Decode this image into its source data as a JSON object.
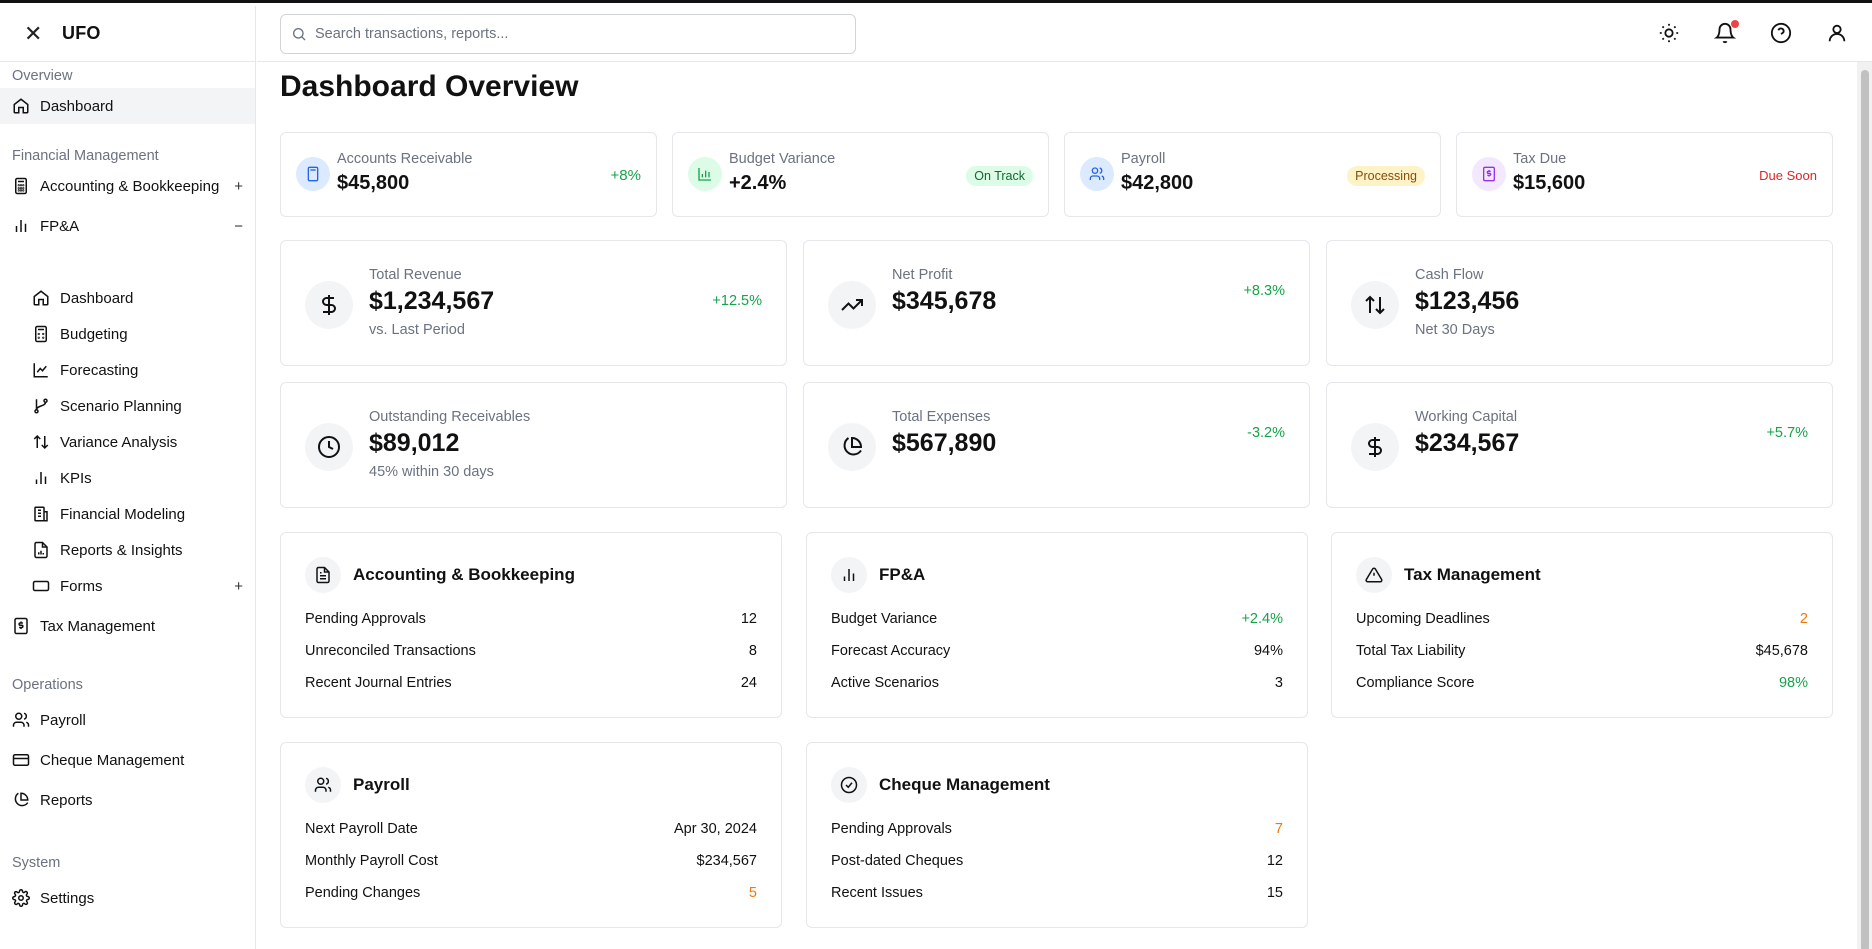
{
  "app": {
    "name": "UFO"
  },
  "search": {
    "placeholder": "Search transactions, reports..."
  },
  "sidebar": {
    "sections": [
      "Overview",
      "Financial Management",
      "Operations",
      "System"
    ],
    "items": {
      "dashboard": "Dashboard",
      "accounting": "Accounting & Bookkeeping",
      "fpa": "FP&A",
      "fpa_dashboard": "Dashboard",
      "budgeting": "Budgeting",
      "forecasting": "Forecasting",
      "scenario": "Scenario Planning",
      "variance": "Variance Analysis",
      "kpis": "KPIs",
      "modeling": "Financial Modeling",
      "reports_insights": "Reports & Insights",
      "forms": "Forms",
      "tax": "Tax Management",
      "payroll": "Payroll",
      "cheque": "Cheque Management",
      "reports": "Reports",
      "settings": "Settings"
    },
    "expand": {
      "plus": "+",
      "minus": "−"
    }
  },
  "page": {
    "title": "Dashboard Overview"
  },
  "summary": [
    {
      "label": "Accounts Receivable",
      "value": "$45,800",
      "tag": "+8%"
    },
    {
      "label": "Budget Variance",
      "value": "+2.4%",
      "tag": "On Track"
    },
    {
      "label": "Payroll",
      "value": "$42,800",
      "tag": "Processing"
    },
    {
      "label": "Tax Due",
      "value": "$15,600",
      "tag": "Due Soon"
    }
  ],
  "metrics": [
    {
      "label": "Total Revenue",
      "value": "$1,234,567",
      "sub": "vs. Last Period",
      "change": "+12.5%"
    },
    {
      "label": "Net Profit",
      "value": "$345,678",
      "change": "+8.3%"
    },
    {
      "label": "Cash Flow",
      "value": "$123,456",
      "sub": "Net 30 Days"
    },
    {
      "label": "Outstanding Receivables",
      "value": "$89,012",
      "sub": "45% within 30 days"
    },
    {
      "label": "Total Expenses",
      "value": "$567,890",
      "change": "-3.2%"
    },
    {
      "label": "Working Capital",
      "value": "$234,567",
      "change": "+5.7%"
    }
  ],
  "modules": [
    {
      "title": "Accounting & Bookkeeping",
      "rows": [
        [
          "Pending Approvals",
          "12"
        ],
        [
          "Unreconciled Transactions",
          "8"
        ],
        [
          "Recent Journal Entries",
          "24"
        ]
      ]
    },
    {
      "title": "FP&A",
      "rows": [
        [
          "Budget Variance",
          "+2.4%"
        ],
        [
          "Forecast Accuracy",
          "94%"
        ],
        [
          "Active Scenarios",
          "3"
        ]
      ]
    },
    {
      "title": "Tax Management",
      "rows": [
        [
          "Upcoming Deadlines",
          "2"
        ],
        [
          "Total Tax Liability",
          "$45,678"
        ],
        [
          "Compliance Score",
          "98%"
        ]
      ]
    },
    {
      "title": "Payroll",
      "rows": [
        [
          "Next Payroll Date",
          "Apr 30, 2024"
        ],
        [
          "Monthly Payroll Cost",
          "$234,567"
        ],
        [
          "Pending Changes",
          "5"
        ]
      ]
    },
    {
      "title": "Cheque Management",
      "rows": [
        [
          "Pending Approvals",
          "7"
        ],
        [
          "Post-dated Cheques",
          "12"
        ],
        [
          "Recent Issues",
          "15"
        ]
      ]
    }
  ],
  "colors": {
    "positive": "#16a34a",
    "negative": "#dc2626",
    "warning": "#ea7a0f"
  }
}
